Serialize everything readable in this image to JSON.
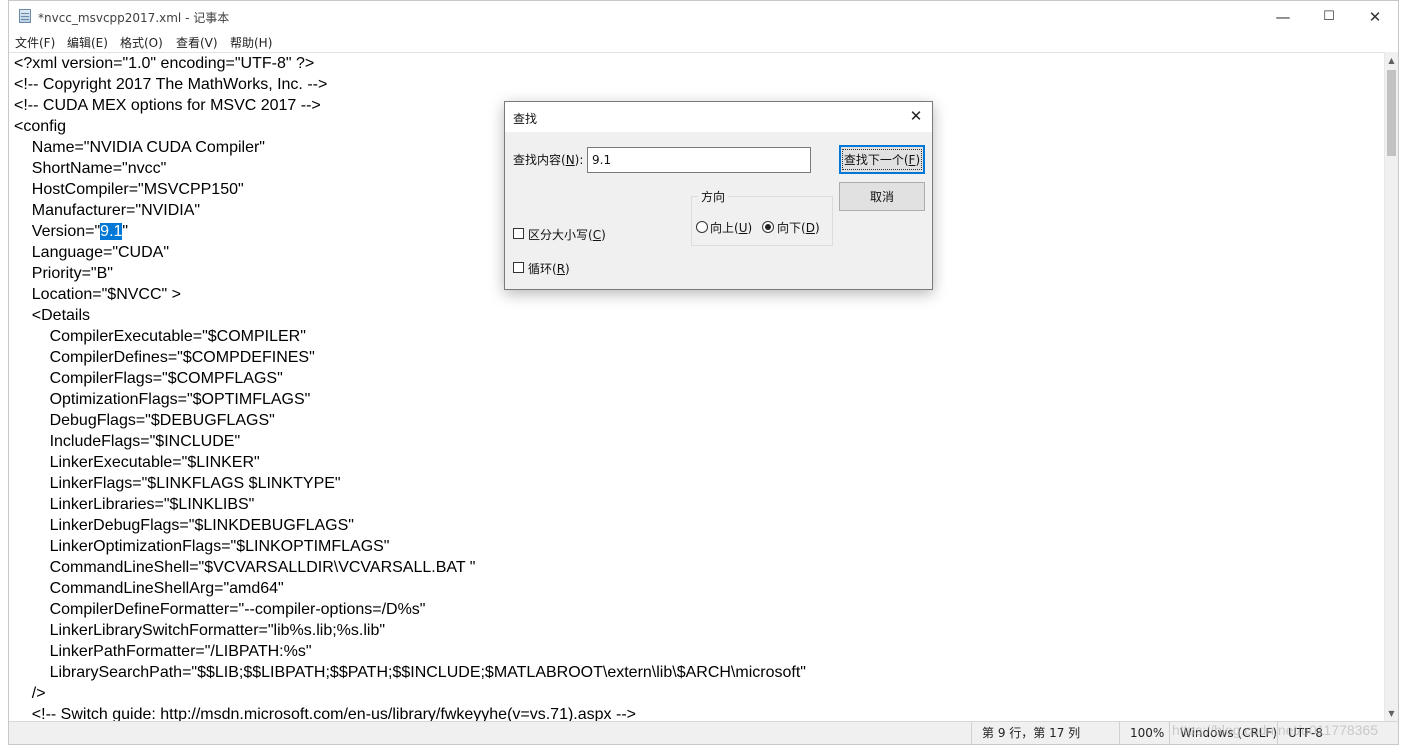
{
  "window": {
    "title": "*nvcc_msvcpp2017.xml - 记事本",
    "minimize_glyph": "—",
    "maximize_glyph": "☐",
    "close_glyph": "✕"
  },
  "menu": [
    "文件(F)",
    "编辑(E)",
    "格式(O)",
    "查看(V)",
    "帮助(H)"
  ],
  "editor": {
    "lines": [
      "<?xml version=\"1.0\" encoding=\"UTF-8\" ?>",
      "<!-- Copyright 2017 The MathWorks, Inc. -->",
      "<!-- CUDA MEX options for MSVC 2017 -->",
      "<config",
      "    Name=\"NVIDIA CUDA Compiler\"",
      "    ShortName=\"nvcc\"",
      "    HostCompiler=\"MSVCPP150\"",
      "    Manufacturer=\"NVIDIA\"",
      "    Version=\"9.1\"",
      "    Language=\"CUDA\"",
      "    Priority=\"B\"",
      "    Location=\"$NVCC\" >",
      "    <Details",
      "        CompilerExecutable=\"$COMPILER\"",
      "        CompilerDefines=\"$COMPDEFINES\"",
      "        CompilerFlags=\"$COMPFLAGS\"",
      "        OptimizationFlags=\"$OPTIMFLAGS\"",
      "        DebugFlags=\"$DEBUGFLAGS\"",
      "        IncludeFlags=\"$INCLUDE\"",
      "        LinkerExecutable=\"$LINKER\"",
      "        LinkerFlags=\"$LINKFLAGS $LINKTYPE\"",
      "        LinkerLibraries=\"$LINKLIBS\"",
      "        LinkerDebugFlags=\"$LINKDEBUGFLAGS\"",
      "        LinkerOptimizationFlags=\"$LINKOPTIMFLAGS\"",
      "        CommandLineShell=\"$VCVARSALLDIR\\VCVARSALL.BAT \"",
      "        CommandLineShellArg=\"amd64\"",
      "        CompilerDefineFormatter=\"--compiler-options=/D%s\"",
      "        LinkerLibrarySwitchFormatter=\"lib%s.lib;%s.lib\"",
      "        LinkerPathFormatter=\"/LIBPATH:%s\"",
      "        LibrarySearchPath=\"$$LIB;$$LIBPATH;$$PATH;$$INCLUDE;$MATLABROOT\\extern\\lib\\$ARCH\\microsoft\"",
      "    />",
      "    <!-- Switch guide: http://msdn.microsoft.com/en-us/library/fwkeyyhe(v=vs.71).aspx -->"
    ],
    "selection": {
      "line_index": 8,
      "before": "    Version=\"",
      "selected": "9.1",
      "after": "\""
    }
  },
  "statusbar": {
    "position": "第 9 行，第 17 列",
    "zoom": "100%",
    "line_ending": "Windows (CRLF)",
    "encoding": "UTF-8"
  },
  "watermark": "https://blog.csdn.net/u011778365",
  "find_dialog": {
    "title": "查找",
    "find_label": "查找内容(N):",
    "find_value": "9.1",
    "find_next_button": "查找下一个(F)",
    "cancel_button": "取消",
    "direction_group": "方向",
    "up_label": "向上(U)",
    "down_label": "向下(D)",
    "direction_selected": "down",
    "match_case_label": "区分大小写(C)",
    "match_case_checked": false,
    "wrap_label": "循环(R)",
    "wrap_checked": false
  }
}
